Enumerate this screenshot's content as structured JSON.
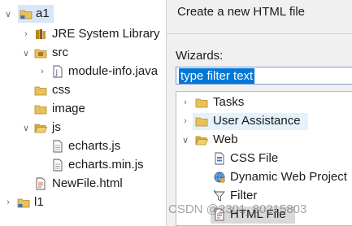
{
  "explorer": {
    "items": [
      {
        "label": "a1",
        "icon": "project-folder-icon",
        "twisty": "expanded"
      },
      {
        "label": "JRE System Library",
        "icon": "library-icon",
        "twisty": "collapsed"
      },
      {
        "label": "src",
        "icon": "source-folder-icon",
        "twisty": "expanded"
      },
      {
        "label": "module-info.java",
        "icon": "java-file-icon",
        "twisty": "collapsed"
      },
      {
        "label": "css",
        "icon": "folder-icon",
        "twisty": "none"
      },
      {
        "label": "image",
        "icon": "folder-icon",
        "twisty": "none"
      },
      {
        "label": "js",
        "icon": "folder-icon",
        "twisty": "expanded"
      },
      {
        "label": "echarts.js",
        "icon": "text-file-icon",
        "twisty": "none"
      },
      {
        "label": "echarts.min.js",
        "icon": "text-file-icon",
        "twisty": "none"
      },
      {
        "label": "NewFile.html",
        "icon": "html-file-icon",
        "twisty": "none"
      },
      {
        "label": "l1",
        "icon": "project-folder-icon",
        "twisty": "collapsed"
      }
    ]
  },
  "wizard": {
    "title": "Create a new HTML file",
    "wizards_label": "Wizards:",
    "filter": {
      "value": "type filter text"
    },
    "tree": [
      {
        "label": "Tasks",
        "icon": "folder-icon",
        "twisty": "collapsed"
      },
      {
        "label": "User Assistance",
        "icon": "folder-icon",
        "twisty": "collapsed"
      },
      {
        "label": "Web",
        "icon": "open-folder-icon",
        "twisty": "expanded"
      },
      {
        "label": "CSS File",
        "icon": "css-file-icon",
        "twisty": "none"
      },
      {
        "label": "Dynamic Web Project",
        "icon": "dynamic-web-project-icon",
        "twisty": "none"
      },
      {
        "label": "Filter",
        "icon": "filter-icon",
        "twisty": "none"
      },
      {
        "label": "HTML File",
        "icon": "html-file-icon",
        "twisty": "none"
      }
    ]
  },
  "watermark": "CSDN @2301_80215803",
  "colors": {
    "selection": "#d9e6f7",
    "filter_highlight": "#0078d7",
    "hover_row": "#e5f1fb",
    "folder_yellow": "#e8c15a"
  }
}
